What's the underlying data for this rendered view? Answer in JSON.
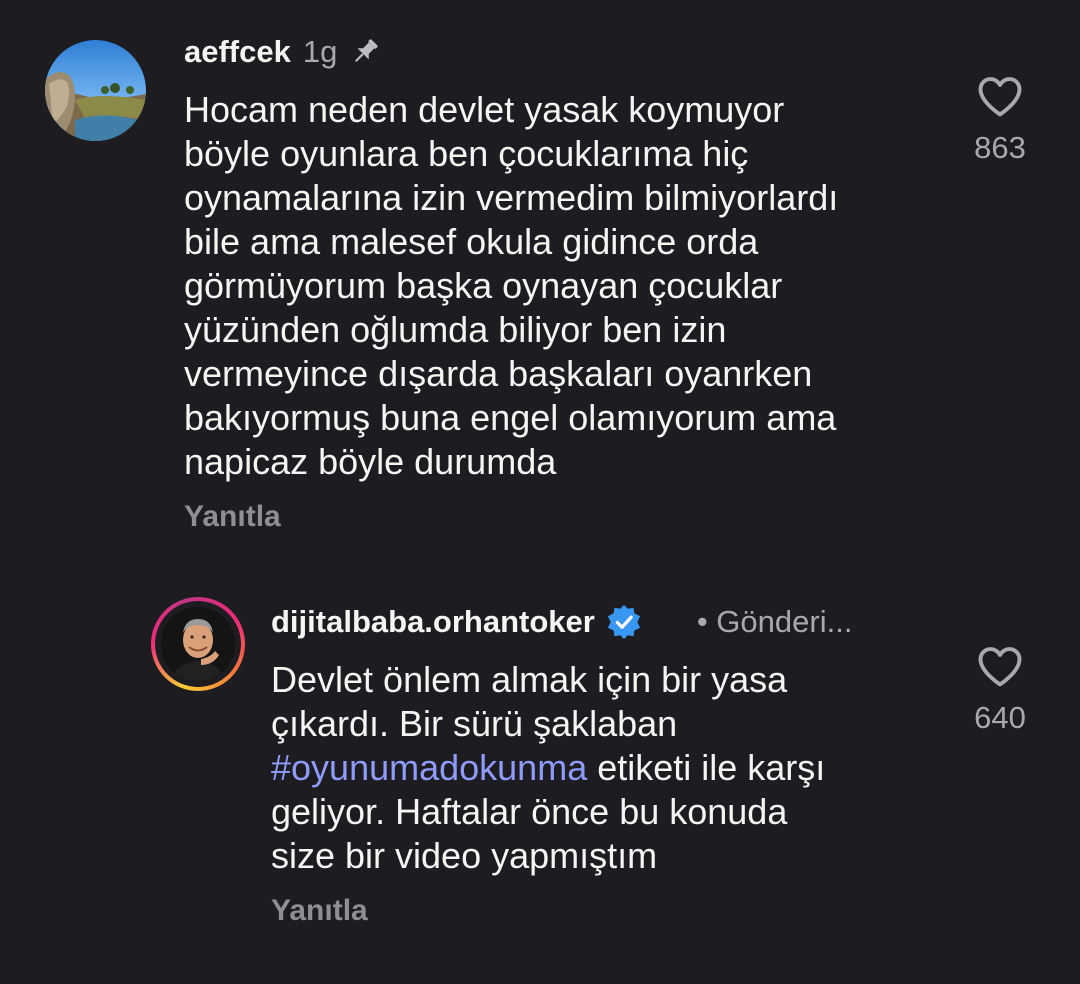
{
  "comments": [
    {
      "username": "aeffcek",
      "time": "1g",
      "pinned": true,
      "text_lines": [
        "Hocam neden devlet yasak koymuyor",
        "böyle oyunlara ben çocuklarıma hiç",
        "oynamalarına izin vermedim bilmiyorlardı",
        "bile ama malesef okula gidince orda",
        "görmüyorum başka oynayan çocuklar",
        "yüzünden oğlumda biliyor ben izin",
        "vermeyince dışarda başkaları oyanrken",
        "bakıyormuş buna engel olamıyorum ama",
        "napicaz böyle durumda"
      ],
      "reply_label": "Yanıtla",
      "like_count": "863",
      "avatar_icon": "landscape-avatar"
    },
    {
      "username": "dijitalbaba.orhantoker",
      "verified": true,
      "status": "• Gönderi...",
      "text_parts": {
        "line1": "Devlet önlem almak için bir yasa",
        "line2": "çıkardı. Bir sürü şaklaban",
        "hashtag": "#oyunumadokunma",
        "line3_rest": " etiketi ile karşı",
        "line4": "geliyor. Haftalar önce bu konuda",
        "line5": "size bir video yapmıştım"
      },
      "reply_label": "Yanıtla",
      "like_count": "640",
      "avatar_icon": "person-avatar"
    }
  ],
  "colors": {
    "background": "#1c1c21",
    "text": "#f5f5f5",
    "muted": "#a8a8ae",
    "hashtag": "#8f9cff",
    "verified": "#3897f0"
  }
}
